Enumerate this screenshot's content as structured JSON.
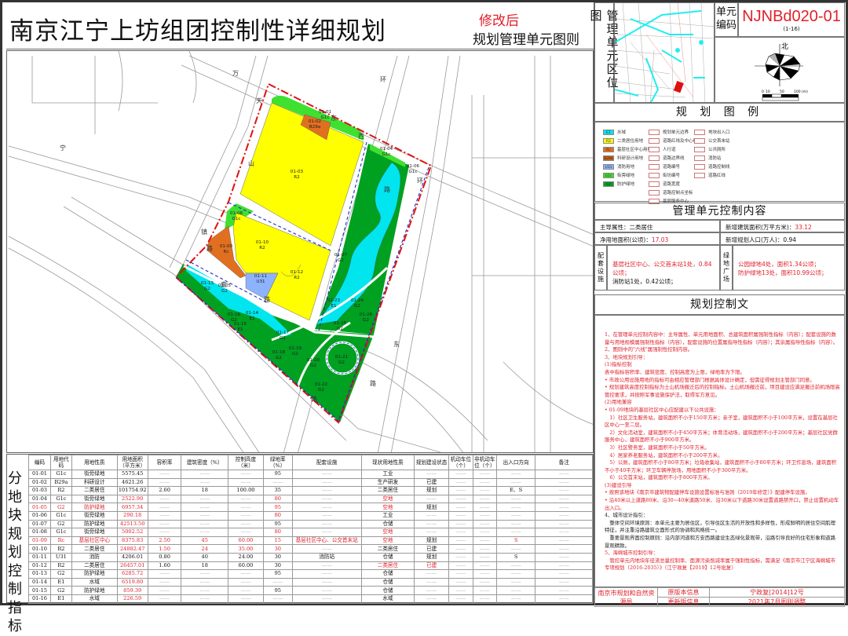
{
  "header": {
    "title": "南京江宁上坊组团控制性详细规划",
    "revision_mark": "修改后",
    "subtitle": "规划管理单元图则"
  },
  "right_panel": {
    "location_label": "管理单元区位图",
    "unit_code_label": "单元编码",
    "unit_code": "NJNBd020-01",
    "unit_range": "(1-16)",
    "compass_label": "北",
    "scale_bar": {
      "ticks": [
        "0",
        "10",
        "50",
        "100"
      ],
      "unit": "(m)"
    },
    "legend_title": "规 划 图 例",
    "legend": [
      {
        "code": "E1",
        "label": "水域",
        "color": "#00e5ee"
      },
      {
        "code": "R2",
        "label": "二类居住用地",
        "color": "#ffff00"
      },
      {
        "code": "Rc",
        "label": "基层社区中心用地",
        "color": "#e07020"
      },
      {
        "code": "B29a",
        "label": "科研设计用地",
        "color": "#d06010"
      },
      {
        "code": "U31",
        "label": "消防用地",
        "color": "#8db3ff"
      },
      {
        "code": "G1c",
        "label": "街旁绿地",
        "color": "#40e030"
      },
      {
        "code": "G2",
        "label": "防护绿地",
        "color": "#00a020"
      },
      {
        "code": "",
        "label": "规划单元边界",
        "color": "#ffffff"
      },
      {
        "code": "",
        "label": "道路红线及中心线",
        "color": "#ffffff"
      },
      {
        "code": "",
        "label": "人行道",
        "color": "#ffffff"
      },
      {
        "code": "",
        "label": "道路边界线",
        "color": "#ffffff"
      },
      {
        "code": "",
        "label": "道路编号",
        "color": "#ffffff"
      },
      {
        "code": "",
        "label": "街坊编号",
        "color": "#ffffff"
      },
      {
        "code": "",
        "label": "道路宽度",
        "color": "#ffffff"
      },
      {
        "code": "",
        "label": "道路控制点坐标",
        "color": "#ffffff"
      },
      {
        "code": "",
        "label": "基层服务中心",
        "color": "#ffffff"
      },
      {
        "code": "",
        "label": "地块出入口",
        "color": "#ffffff"
      },
      {
        "code": "",
        "label": "公交首末站",
        "color": "#ffffff"
      },
      {
        "code": "",
        "label": "公共厕所",
        "color": "#ffffff"
      },
      {
        "code": "",
        "label": "消防站",
        "color": "#ffffff"
      },
      {
        "code": "",
        "label": "道路控制线",
        "color": "#ffffff"
      },
      {
        "code": "",
        "label": "道路红线",
        "color": "#ffffff"
      }
    ],
    "control_title": "管理单元控制内容",
    "dominant_use_label": "主导属性：",
    "dominant_use": "二类居住",
    "new_floor_area_label": "新增建筑面积(万平方米)：",
    "new_floor_area": "33.12",
    "net_land_label": "净用地面积(公顷)：",
    "net_land": "17.03",
    "new_population_label": "新增规划人口(万人)：",
    "new_population": "0.94",
    "facilities_label": "配套设施",
    "facilities_red": "基层社区中心、公交首末站1处，0.84公顷；",
    "facilities_black": "消防站1处，0.42公顷；",
    "green_label": "绿地广场",
    "green_1": "公园绿地4处，面积1.34公顷；",
    "green_2": "防护绿地13处，面积10.99公顷；",
    "text_title": "规划控制文",
    "text": [
      {
        "t": "1、在管理单元控制内容中：主导属性、单元用地面积、总建筑面积属强制性指标（内容）；配套设施的数量与用地规模属强制性指标（内容），配套设施的位置属指导性指标（内容）；其余属指导性指标（内容）。",
        "c": "r"
      },
      {
        "t": "2、图则中的\"六线\"属强制性控制内容。",
        "c": "r"
      },
      {
        "t": "3、地块规划引导：",
        "c": "r"
      },
      {
        "t": "(1)指标控制",
        "c": "r"
      },
      {
        "t": "表中指标容积率、建筑密度、控制高度为上限，绿地率为下限。",
        "c": "r"
      },
      {
        "t": "• 市政公用设施用地的指标可由相应管理部门根据具体设计确定，但需征得规划主管部门同意。",
        "c": "r"
      },
      {
        "t": "• 规划建筑高度控制指标为土山机场搬迁后的控制指标。土山机场搬迁前，项目建设应满足搬迁前机场限高管控要求，并按照军事设施保护法，取得军方意见。",
        "c": "r"
      },
      {
        "t": "(2)用地兼容",
        "c": "r"
      },
      {
        "t": "• 01-09地块的基层社区中心应配建以下公共设施：",
        "c": "r"
      },
      {
        "t": "　1）社区卫生服务站，建筑面积不小于150平方米；亲子室，建筑面积不小于100平方米，设置在基层社区中心一至二层。",
        "c": "r"
      },
      {
        "t": "　2）文化活动室，建筑面积不小于450平方米；体育活动场，建筑面积不小于200平方米；基层社区党群服务中心，建筑面积不小于900平方米。",
        "c": "r"
      },
      {
        "t": "　3）社区警务室，建筑面积不小于50平方米。",
        "c": "r"
      },
      {
        "t": "　4）居家养老服务站，建筑面积不小于200平方米。",
        "c": "r"
      },
      {
        "t": "　5）公厕，建筑面积不小于80平方米；垃圾收集站，建筑面积不小于80平方米；环卫作息场，建筑面积不小于40平方米；环卫车辆停放场，用地面积不小于300平方米。",
        "c": "r"
      },
      {
        "t": "　6）公交首末站，建筑面积不小于800平方米。",
        "c": "r"
      },
      {
        "t": "(3)建设引导",
        "c": "r"
      },
      {
        "t": "• 按照该地块《南京市建筑物配建停车设施设置标准与准则（2019年修定）》配建停车设施。",
        "c": "r"
      },
      {
        "t": "• 沿40米以上道路80米、沿30~40米道路50米、沿30米以下道路30米设置道路禁开口，禁止设置机动车出入口。",
        "c": "r"
      },
      {
        "t": "4、城市设计指引：",
        "c": "b"
      },
      {
        "t": "　整体空间环境原则：本单元主要为居住区，引导住区生活的开放性和多样性，形成鲜明的居住空间肌理特征，并注重沿路建筑立面形式的协调和风格统一。",
        "c": "b"
      },
      {
        "t": "　重要景观界面控制原则：沿内部河道和方安西路建设生态绿化景观带，沿路引导良好的住宅形象和道路景观精致。",
        "c": "b"
      },
      {
        "t": "5、海绵城市控制引导：",
        "c": "r"
      },
      {
        "t": "　管控单元内地块年径流总量控制率、面源污染削减率属于强制性指标，需满足《南京市江宁区海绵城市专项规划（2016-2035）》（江宁政复【2019】12号批复）",
        "c": "r"
      }
    ],
    "footer": {
      "org": "南京市规划和自然资源局",
      "orig_label": "原版本信息",
      "orig_value": "宁政复[2014]12号",
      "update_label": "更新版信息",
      "update_value": "2021年7月图则调整"
    }
  },
  "table": {
    "side_label": "分地块规划控制指标",
    "headers": [
      "编码",
      "用地代码",
      "用地性质",
      "用地面积（平方米）",
      "容积率",
      "建筑密度（%）",
      "控制高度（米）",
      "绿地率（%）",
      "配套设施",
      "现状用地性质",
      "规划建设状态",
      "机动车位（个）",
      "非机动车位（个）",
      "出入口方向",
      "备注"
    ],
    "rows": [
      {
        "c": [
          "01-01",
          "G1c",
          "街旁绿地",
          "5575.45",
          "——",
          "——",
          "——",
          "95",
          "——",
          "工业",
          "——",
          "——",
          "——",
          "——",
          "——"
        ],
        "red": []
      },
      {
        "c": [
          "01-02",
          "B29a",
          "科研设计",
          "4621.26",
          "——",
          "——",
          "——",
          "——",
          "——",
          "生产研发",
          "已建",
          "——",
          "——",
          "——",
          "——"
        ],
        "red": []
      },
      {
        "c": [
          "01-03",
          "R2",
          "二类居住",
          "101754.92",
          "2.60",
          "18",
          "100.00",
          "35",
          "——",
          "二类居住",
          "规划",
          "——",
          "——",
          "E、S",
          "——"
        ],
        "red": []
      },
      {
        "c": [
          "01-04",
          "G1c",
          "街旁绿地",
          "2522.90",
          "——",
          "——",
          "——",
          "80",
          "——",
          "空地",
          "——",
          "——",
          "——",
          "——",
          "——"
        ],
        "red": [
          3,
          7,
          9
        ]
      },
      {
        "c": [
          "01-05",
          "G2",
          "防护绿地",
          "6957.34",
          "——",
          "——",
          "——",
          "95",
          "——",
          "空地",
          "规划",
          "——",
          "——",
          "——",
          "——"
        ],
        "red": [
          0,
          1,
          2,
          3,
          7,
          9,
          13
        ]
      },
      {
        "c": [
          "01-06",
          "G1c",
          "街旁绿地",
          "290.18",
          "——",
          "——",
          "——",
          "80",
          "——",
          "工业",
          "——",
          "——",
          "——",
          "——",
          "——"
        ],
        "red": [
          3,
          7
        ]
      },
      {
        "c": [
          "01-07",
          "G2",
          "防护绿地",
          "42513.50",
          "——",
          "——",
          "——",
          "95",
          "——",
          "仓储",
          "——",
          "——",
          "——",
          "——",
          "——"
        ],
        "red": [
          3
        ]
      },
      {
        "c": [
          "01-08",
          "G1c",
          "街旁绿地",
          "5002.52",
          "——",
          "——",
          "——",
          "80",
          "——",
          "空地",
          "——",
          "——",
          "——",
          "——",
          "——"
        ],
        "red": [
          3,
          7,
          9
        ]
      },
      {
        "c": [
          "01-09",
          "Rc",
          "基层社区中心",
          "8375.83",
          "2.50",
          "45",
          "60.00",
          "15",
          "基层社区中心、公交首末站",
          "空地",
          "规划",
          "——",
          "——",
          "S",
          "——"
        ],
        "red": [
          0,
          1,
          2,
          3,
          4,
          5,
          6,
          7,
          8,
          9,
          13
        ]
      },
      {
        "c": [
          "01-10",
          "R2",
          "二类居住",
          "24882.47",
          "1.50",
          "24",
          "35.00",
          "30",
          "——",
          "二类居住",
          "已建",
          "——",
          "——",
          "——",
          "——"
        ],
        "red": [
          3,
          4,
          5,
          6,
          7
        ]
      },
      {
        "c": [
          "01-11",
          "U31",
          "消防",
          "4206.01",
          "0.80",
          "40",
          "24.00",
          "30",
          "消防站",
          "仓储",
          "规划",
          "——",
          "——",
          "S",
          "——"
        ],
        "red": []
      },
      {
        "c": [
          "01-12",
          "R2",
          "二类居住",
          "26457.01",
          "1.60",
          "18",
          "60.00",
          "30",
          "——",
          "二类居住",
          "已建",
          "——",
          "——",
          "——",
          "——"
        ],
        "red": [
          3,
          9,
          10,
          13
        ]
      },
      {
        "c": [
          "01-13",
          "G2",
          "防护绿地",
          "6285.72",
          "——",
          "——",
          "——",
          "95",
          "——",
          "仓储",
          "——",
          "——",
          "——",
          "——",
          "——"
        ],
        "red": [
          3
        ]
      },
      {
        "c": [
          "01-14",
          "E1",
          "水域",
          "6519.80",
          "——",
          "——",
          "——",
          "——",
          "——",
          "仓储",
          "——",
          "——",
          "——",
          "——",
          "——"
        ],
        "red": [
          3
        ]
      },
      {
        "c": [
          "01-15",
          "G2",
          "防护绿地",
          "859.39",
          "——",
          "——",
          "——",
          "95",
          "——",
          "仓储",
          "——",
          "——",
          "——",
          "——",
          "——"
        ],
        "red": [
          3
        ]
      },
      {
        "c": [
          "01-16",
          "E1",
          "水域",
          "226.59",
          "——",
          "——",
          "——",
          "——",
          "——",
          "水域",
          "——",
          "——",
          "——",
          "——",
          "——"
        ],
        "red": [
          3
        ]
      }
    ]
  },
  "map": {
    "parcels": [
      {
        "code": "01-01",
        "use": "G1c"
      },
      {
        "code": "01-02",
        "use": "B29a"
      },
      {
        "code": "01-03",
        "use": "R2"
      },
      {
        "code": "01-04",
        "use": "G1c"
      },
      {
        "code": "01-06",
        "use": "G1c"
      },
      {
        "code": "01-08",
        "use": "G1c"
      },
      {
        "code": "01-09",
        "use": "Rc"
      },
      {
        "code": "01-10",
        "use": "R2"
      },
      {
        "code": "01-11",
        "use": "U31"
      },
      {
        "code": "01-12",
        "use": "R2"
      },
      {
        "code": "01-07",
        "use": "G2"
      },
      {
        "code": "01-13",
        "use": "G2"
      },
      {
        "code": "01-05",
        "use": "G2"
      },
      {
        "code": "01-23",
        "use": "E1"
      },
      {
        "code": "01-24",
        "use": "G2"
      },
      {
        "code": "01-26",
        "use": "G2"
      },
      {
        "code": "01-16",
        "use": "G2"
      },
      {
        "code": "01-14",
        "use": "E1"
      },
      {
        "code": "01-15",
        "use": "E1"
      },
      {
        "code": "01-25",
        "use": "G2"
      },
      {
        "code": "01-17",
        "use": "G2"
      },
      {
        "code": "01-19",
        "use": "G2"
      },
      {
        "code": "01-18",
        "use": "G2"
      },
      {
        "code": "01-20",
        "use": "G2"
      },
      {
        "code": "01-21",
        "use": "G2"
      },
      {
        "code": "01-22",
        "use": "G2"
      }
    ],
    "road_labels": [
      "万",
      "环",
      "天",
      "山",
      "东",
      "西",
      "路",
      "宁",
      "环",
      "镇",
      "路",
      "南",
      "路",
      "东",
      "路",
      "路"
    ]
  }
}
